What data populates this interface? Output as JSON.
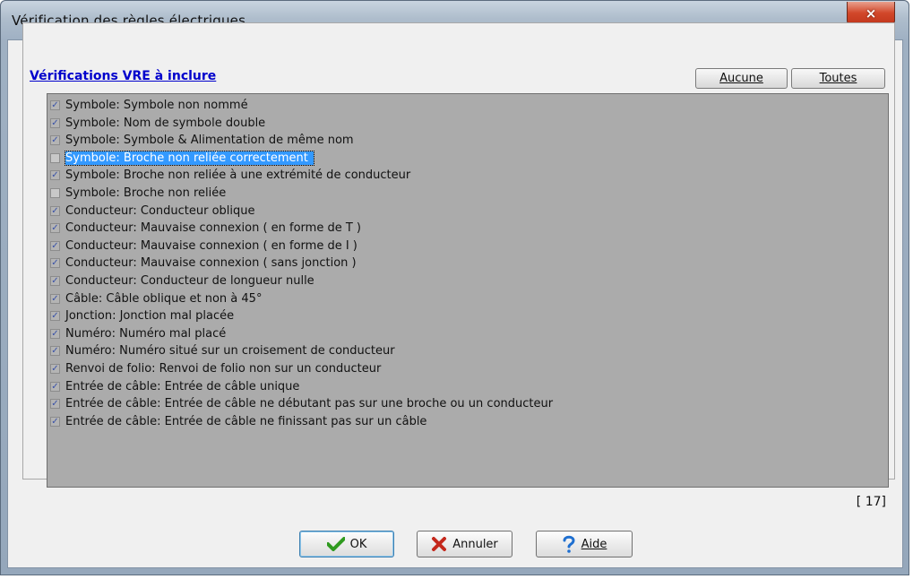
{
  "window": {
    "title": "Vérification des règles électriques",
    "close_icon": "×"
  },
  "section": {
    "title": "Vérifications VRE à inclure"
  },
  "buttons": {
    "none_label": "Aucune",
    "all_label": "Toutes",
    "ok_label": "OK",
    "cancel_label": "Annuler",
    "help_label": "Aide"
  },
  "checks": [
    {
      "label": "Symbole: Symbole non nommé",
      "checked": true
    },
    {
      "label": "Symbole: Nom de symbole double",
      "checked": true
    },
    {
      "label": "Symbole: Symbole & Alimentation de même nom",
      "checked": true
    },
    {
      "label": "Symbole: Broche non reliée correctement",
      "checked": false,
      "selected": true
    },
    {
      "label": "Symbole: Broche non reliée à une extrémité de conducteur",
      "checked": true
    },
    {
      "label": "Symbole: Broche non reliée",
      "checked": false
    },
    {
      "label": "Conducteur: Conducteur oblique",
      "checked": true
    },
    {
      "label": "Conducteur: Mauvaise connexion ( en forme de T )",
      "checked": true
    },
    {
      "label": "Conducteur: Mauvaise connexion ( en forme de I )",
      "checked": true
    },
    {
      "label": "Conducteur: Mauvaise connexion ( sans jonction )",
      "checked": true
    },
    {
      "label": "Conducteur: Conducteur de longueur nulle",
      "checked": true
    },
    {
      "label": "Câble: Câble oblique et non à 45°",
      "checked": true
    },
    {
      "label": "Jonction: Jonction mal placée",
      "checked": true
    },
    {
      "label": "Numéro: Numéro mal placé",
      "checked": true
    },
    {
      "label": "Numéro: Numéro situé sur un croisement de conducteur",
      "checked": true
    },
    {
      "label": "Renvoi de folio: Renvoi de folio non sur un conducteur",
      "checked": true
    },
    {
      "label": "Entrée de câble: Entrée de câble unique",
      "checked": true
    },
    {
      "label": "Entrée de câble: Entrée de câble ne débutant pas sur une broche ou un conducteur",
      "checked": true
    },
    {
      "label": "Entrée de câble: Entrée de câble ne finissant pas sur un câble",
      "checked": true
    }
  ],
  "count": "[ 17]",
  "colors": {
    "selection": "#3399ff",
    "check": "#3a52a8",
    "section_title": "#0000cc",
    "ok_icon": "#2f9a1f",
    "cancel_icon": "#c4281c",
    "help_icon": "#1e6fd0"
  },
  "icons": {
    "ok": "checkmark-icon",
    "cancel": "x-mark-icon",
    "help": "question-mark-icon"
  }
}
